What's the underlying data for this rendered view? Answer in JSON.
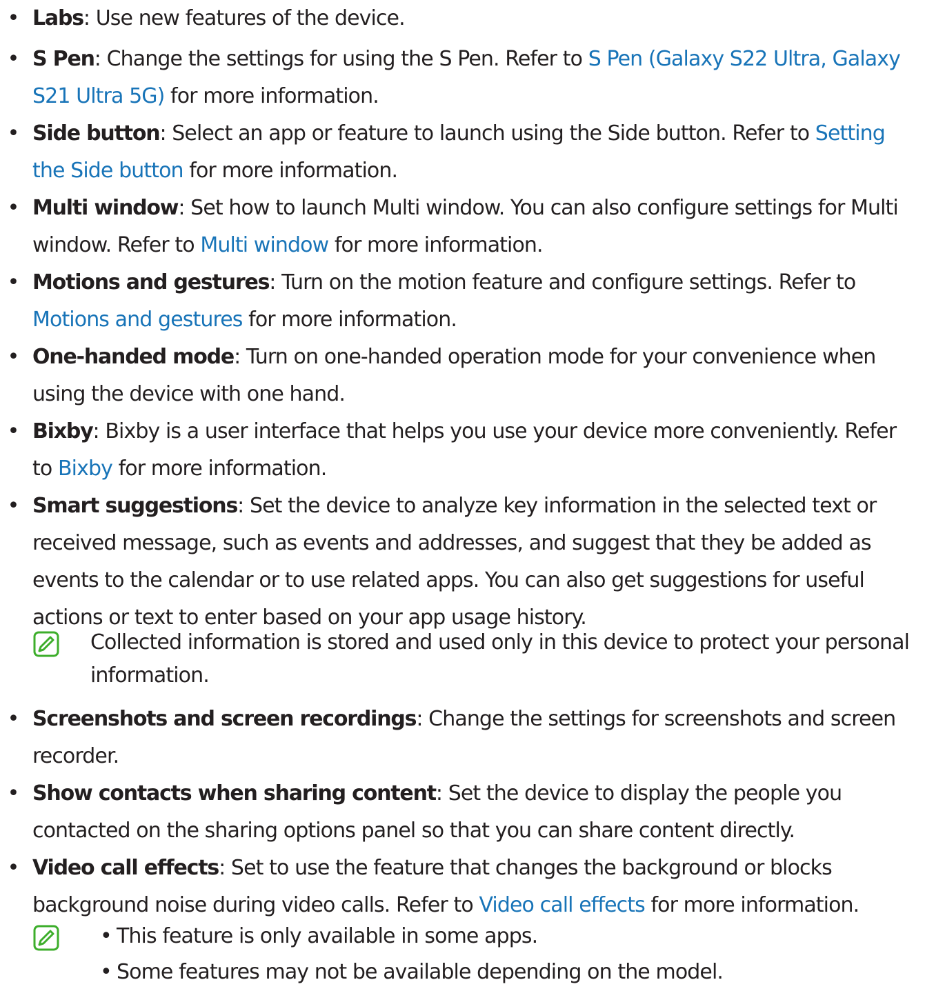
{
  "items": [
    {
      "term": "Labs",
      "text_before": ": Use new features of the device.",
      "link": "",
      "text_after": ""
    },
    {
      "term": "S Pen",
      "text_before": ": Change the settings for using the S Pen. Refer to ",
      "link": "S Pen (Galaxy S22 Ultra, Galaxy S21 Ultra 5G)",
      "text_after": " for more information."
    },
    {
      "term": "Side button",
      "text_before": ": Select an app or feature to launch using the Side button. Refer to ",
      "link": "Setting the Side button",
      "text_after": " for more information."
    },
    {
      "term": "Multi window",
      "text_before": ": Set how to launch Multi window. You can also configure settings for Multi window. Refer to ",
      "link": "Multi window",
      "text_after": " for more information."
    },
    {
      "term": "Motions and gestures",
      "text_before": ": Turn on the motion feature and configure settings. Refer to ",
      "link": "Motions and gestures",
      "text_after": " for more information."
    },
    {
      "term": "One-handed mode",
      "text_before": ": Turn on one-handed operation mode for your convenience when using the device with one hand.",
      "link": "",
      "text_after": ""
    },
    {
      "term": "Bixby",
      "text_before": ": Bixby is a user interface that helps you use your device more conveniently. Refer to ",
      "link": "Bixby",
      "text_after": " for more information."
    },
    {
      "term": "Smart suggestions",
      "text_before": ": Set the device to analyze key information in the selected text or received message, such as events and addresses, and suggest that they be added as events to the calendar or to use related apps. You can also get suggestions for useful actions or text to enter based on your app usage history.",
      "link": "",
      "text_after": ""
    },
    {
      "term": "Screenshots and screen recordings",
      "text_before": ": Change the settings for screenshots and screen recorder.",
      "link": "",
      "text_after": ""
    },
    {
      "term": "Show contacts when sharing content",
      "text_before": ": Set the device to display the people you contacted on the sharing options panel so that you can share content directly.",
      "link": "",
      "text_after": ""
    },
    {
      "term": "Video call effects",
      "text_before": ": Set to use the feature that changes the background or blocks background noise during video calls. Refer to ",
      "link": "Video call effects",
      "text_after": " for more information."
    }
  ],
  "note1": {
    "icon": "note-pen-icon",
    "text": "Collected information is stored and used only in this device to protect your personal information."
  },
  "note2": {
    "icon": "note-pen-icon",
    "bullets": [
      "This feature is only available in some apps.",
      "Some features may not be available depending on the model."
    ]
  },
  "bullet_char": "•",
  "colors": {
    "text": "#231f20",
    "link": "#1874b8",
    "icon_green": "#3dae2b"
  }
}
